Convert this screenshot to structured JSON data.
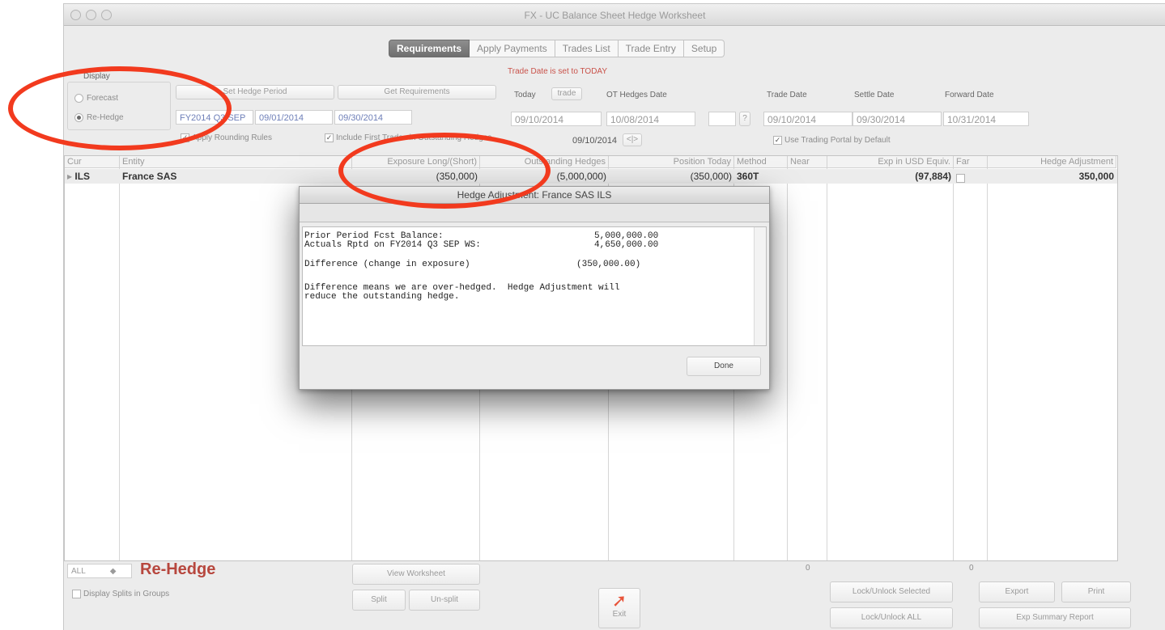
{
  "window": {
    "title": "FX - UC Balance Sheet Hedge Worksheet"
  },
  "tabs": [
    {
      "label": "Requirements",
      "active": true
    },
    {
      "label": "Apply Payments",
      "active": false
    },
    {
      "label": "Trades List",
      "active": false
    },
    {
      "label": "Trade Entry",
      "active": false
    },
    {
      "label": "Setup",
      "active": false
    }
  ],
  "notice": "Trade Date is set to TODAY",
  "display": {
    "label": "Display",
    "options": [
      {
        "label": "Forecast",
        "selected": false
      },
      {
        "label": "Re-Hedge",
        "selected": true
      }
    ]
  },
  "period": {
    "set_button": "Set Hedge Period",
    "get_button": "Get Requirements",
    "name": "FY2014 Q3 SEP",
    "start": "09/01/2014",
    "end": "09/30/2014",
    "apply_rounding": "Apply Rounding Rules",
    "include_trades": "Include First Trades in Outstanding Hedges"
  },
  "dates": {
    "today_label": "Today",
    "trade_button": "trade",
    "today_value": "09/10/2014",
    "ot_hedges_label": "OT Hedges Date",
    "ot_hedges_value": "10/08/2014",
    "help": "?",
    "mid_date": "09/10/2014",
    "trade_date_label": "Trade Date",
    "trade_date_value": "09/10/2014",
    "settle_date_label": "Settle Date",
    "settle_date_value": "09/30/2014",
    "forward_date_label": "Forward Date",
    "forward_date_value": "10/31/2014",
    "use_portal": "Use Trading Portal by Default"
  },
  "table": {
    "headers": [
      "Cur",
      "Entity",
      "Exposure Long/(Short)",
      "Outstanding Hedges",
      "Position Today",
      "Method",
      "Near",
      "Exp in USD Equiv.",
      "Far",
      "Hedge Adjustment"
    ],
    "rows": [
      {
        "cur": "ILS",
        "entity": "France SAS",
        "exposure": "(350,000)",
        "outstanding": "(5,000,000)",
        "position": "(350,000)",
        "method": "360T",
        "near": "",
        "usd": "(97,884)",
        "far": "",
        "adjustment": "350,000"
      }
    ]
  },
  "dialog": {
    "title": "Hedge Adjustment: France SAS ILS",
    "lines": [
      {
        "label": "Prior Period Fcst Balance:",
        "value": "5,000,000.00"
      },
      {
        "label": "Actuals Rptd on FY2014 Q3 SEP WS:",
        "value": "4,650,000.00"
      },
      {
        "label": "Difference (change in exposure)",
        "value": "(350,000.00)"
      }
    ],
    "message1": "Difference means we are over-hedged.  Hedge Adjustment will",
    "message2": "reduce the outstanding hedge.",
    "done": "Done"
  },
  "footer": {
    "filter": "ALL",
    "mode": "Re-Hedge",
    "display_splits": "Display Splits in Groups",
    "view_worksheet": "View Worksheet",
    "split": "Split",
    "unsplit": "Un-split",
    "exit": "Exit",
    "count_near": "0",
    "count_far": "0",
    "lock_selected": "Lock/Unlock Selected",
    "lock_all": "Lock/Unlock ALL",
    "export": "Export",
    "print": "Print",
    "summary": "Exp Summary Report"
  }
}
